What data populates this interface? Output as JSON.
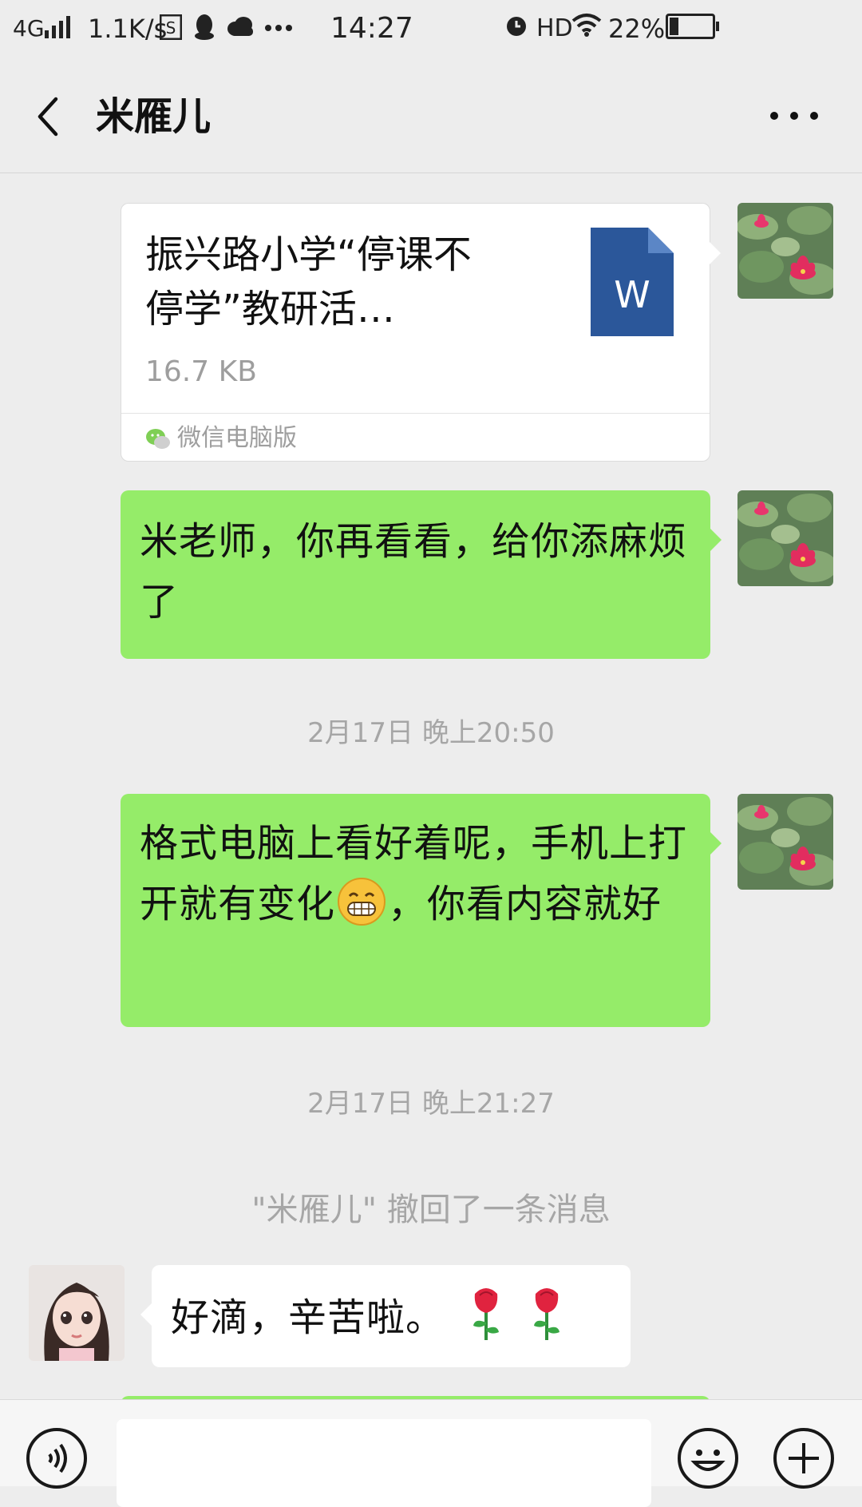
{
  "status_bar": {
    "network": "4G",
    "speed": "1.1K/s",
    "time": "14:27",
    "hd": "HD",
    "battery": "22%",
    "battery_level": 0.22
  },
  "header": {
    "title": "米雁儿"
  },
  "messages": {
    "file": {
      "title": "振兴路小学“停课不停学”教研活…",
      "size": "16.7 KB",
      "source": "微信电脑版",
      "icon_letter": "W"
    },
    "m1": {
      "text": "米老师，你再看看，给你添麻烦了"
    },
    "ts1": "2月17日 晚上20:50",
    "m2": {
      "text_before": "格式电脑上看好着呢，手机上打开就有变化",
      "text_after": "，你看内容就好"
    },
    "ts2": "2月17日 晚上21:27",
    "recall": "\"米雁儿\" 撤回了一条消息",
    "m3": {
      "text": "好滴，辛苦啦。"
    }
  },
  "colors": {
    "sent_bubble": "#95ec69",
    "received_bubble": "#ffffff",
    "background": "#ededed",
    "word_icon": "#2b579a"
  }
}
